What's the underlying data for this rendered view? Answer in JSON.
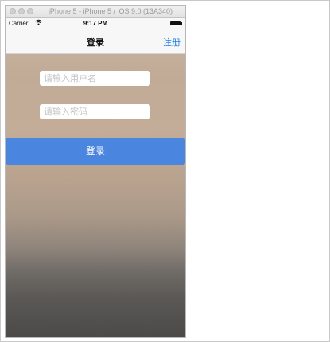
{
  "simulator": {
    "title": "iPhone 5 - iPhone 5 / iOS 9.0 (13A340)"
  },
  "status_bar": {
    "carrier": "Carrier",
    "wifi_icon": "wifi-icon",
    "time": "9:17 PM",
    "battery_icon": "battery-icon"
  },
  "nav": {
    "title": "登录",
    "right_button": "注册"
  },
  "form": {
    "username_placeholder": "请输入用户名",
    "username_value": "",
    "password_placeholder": "请输入密码",
    "password_value": "",
    "submit_label": "登录"
  },
  "colors": {
    "accent": "#4a86e0",
    "link": "#1a7cf5"
  }
}
